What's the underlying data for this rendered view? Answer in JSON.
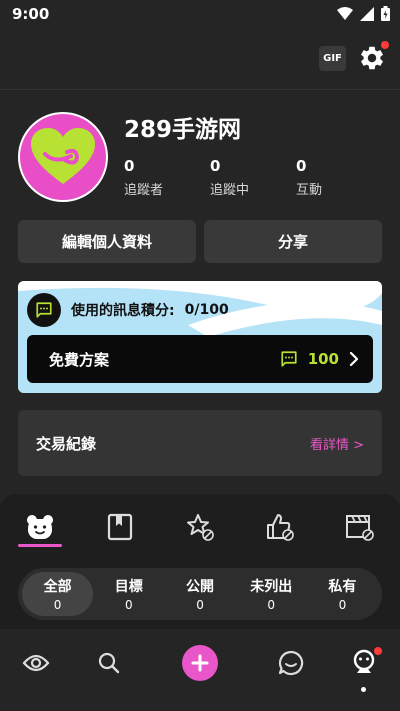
{
  "status_bar": {
    "time": "9:00"
  },
  "top_actions": {
    "gif_label": "GIF"
  },
  "profile": {
    "username": "289手游网",
    "stats": [
      {
        "count": "0",
        "label": "追蹤者"
      },
      {
        "count": "0",
        "label": "追蹤中"
      },
      {
        "count": "0",
        "label": "互動"
      }
    ],
    "edit_label": "編輯個人資料",
    "share_label": "分享"
  },
  "credits": {
    "label": "使用的訊息積分:",
    "value": "0/100",
    "plan_name": "免費方案",
    "plan_credits": "100",
    "accent_color": "#b7e234"
  },
  "transactions": {
    "title": "交易紀錄",
    "link": "看詳情 >"
  },
  "content_tabs": [
    "bear-icon",
    "book-icon",
    "star-hidden-icon",
    "thumb-hidden-icon",
    "clapper-hidden-icon"
  ],
  "filters": [
    {
      "label": "全部",
      "count": "0"
    },
    {
      "label": "目標",
      "count": "0"
    },
    {
      "label": "公開",
      "count": "0"
    },
    {
      "label": "未列出",
      "count": "0"
    },
    {
      "label": "私有",
      "count": "0"
    }
  ],
  "bottom_nav": [
    "eye-icon",
    "search-icon",
    "add-icon",
    "chat-icon",
    "profile-icon"
  ],
  "colors": {
    "accent": "#e956c9",
    "background": "#262525",
    "card": "#353434",
    "notification": "#ff3b3b"
  }
}
